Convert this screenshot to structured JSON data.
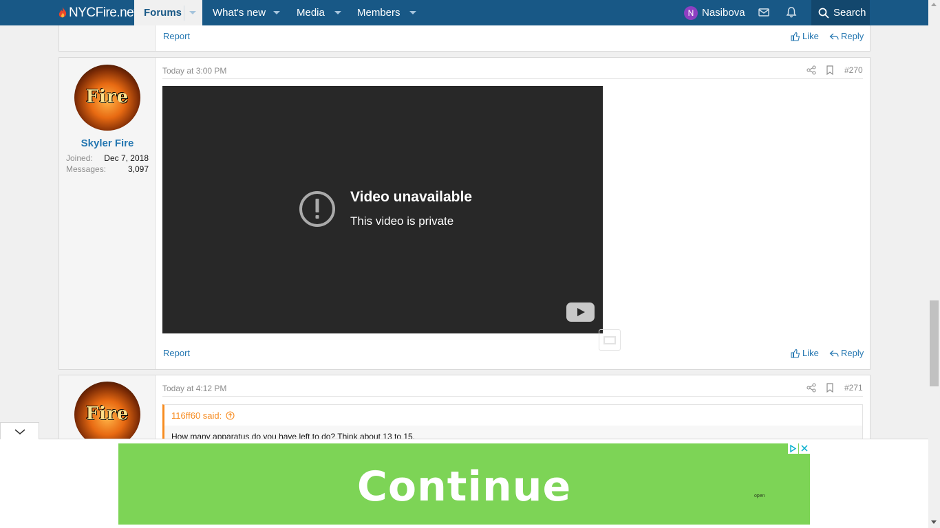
{
  "site": {
    "name": "NYCFire.net"
  },
  "nav": {
    "tabs": [
      {
        "label": "Forums"
      },
      {
        "label": "What's new"
      },
      {
        "label": "Media"
      },
      {
        "label": "Members"
      }
    ],
    "username": "Nasibova",
    "avatar_initial": "N",
    "avatar_color": "#8e3fc2",
    "search_label": "Search"
  },
  "colors": {
    "header": "#185886",
    "link": "#2577b1",
    "quote_accent": "#f78b1f",
    "ad_green": "#7dd456"
  },
  "prev_post": {
    "report": "Report",
    "like": "Like",
    "reply": "Reply"
  },
  "post270": {
    "time": "Today at 3:00 PM",
    "number": "#270",
    "author": "Skyler Fire",
    "avatar_text": "Fire",
    "joined_label": "Joined:",
    "joined": "Dec 7, 2018",
    "messages_label": "Messages:",
    "messages": "3,097",
    "video_title": "Video unavailable",
    "video_subtitle": "This video is private",
    "report": "Report",
    "like": "Like",
    "reply": "Reply"
  },
  "post271": {
    "time": "Today at 4:12 PM",
    "number": "#271",
    "avatar_text": "Fire",
    "quote_author": "116ff60 said:",
    "quote_text": "How many apparatus do you have left to do? Think about 13 to 15."
  },
  "ad": {
    "headline": "Continue",
    "small": "open"
  }
}
